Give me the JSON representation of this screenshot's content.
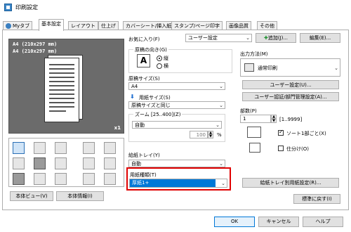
{
  "window": {
    "title": "印刷設定"
  },
  "tabs": [
    {
      "label": "Myタブ"
    },
    {
      "label": "基本設定"
    },
    {
      "label": "レイアウト"
    },
    {
      "label": "仕上げ"
    },
    {
      "label": "カバーシート/挿入紙"
    },
    {
      "label": "スタンプ/ページ印字"
    },
    {
      "label": "画像品質"
    },
    {
      "label": "その他"
    }
  ],
  "preview": {
    "size_line1": "A4 (210x297 mm)",
    "size_line2": "A4 (210x297 mm)",
    "count": "x1"
  },
  "favorites": {
    "label": "お気に入り(F)",
    "value": "ユーザー設定",
    "add_label": "追加(J)...",
    "edit_label": "編集(E)..."
  },
  "orientation": {
    "label": "原稿の向き(G)",
    "portrait": "縦",
    "landscape": "横"
  },
  "original_size": {
    "label": "原稿サイズ(S)",
    "value": "A4"
  },
  "paper_size": {
    "label": "用紙サイズ(S)",
    "value": "原稿サイズと同じ"
  },
  "zoom": {
    "label": "ズーム [25..400](Z)",
    "mode": "自動",
    "value": "100",
    "unit": "%"
  },
  "paper_tray": {
    "label": "給紙トレイ(Y)",
    "value": "自動"
  },
  "paper_type": {
    "label": "用紙種類(T)",
    "value": "厚紙1+"
  },
  "output": {
    "label": "出力方法(M)",
    "value": "通常印刷",
    "user_settings": "ユーザー設定(U)...",
    "auth": "ユーザー認証/部門管理設定(A)..."
  },
  "copies": {
    "label": "部数(P)",
    "value": "1",
    "range": "[1..9999]",
    "collate": "ソート1部ごと(X)",
    "offset": "仕分け(O)"
  },
  "tray_settings_button": "給紙トレイ別用紙設定(R)...",
  "defaults_button": "標準に戻す(I)",
  "printer_view_button": "本体ビュー(V)",
  "printer_info_button": "本体情報(I)",
  "footer": {
    "ok": "OK",
    "cancel": "キャンセル",
    "help": "ヘルプ"
  },
  "colors": {
    "highlight": "#e00000",
    "selection": "#0078d7"
  }
}
